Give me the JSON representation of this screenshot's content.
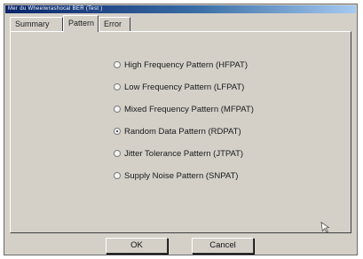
{
  "window": {
    "title": "Mer du Wheelwrashocal BER (Test )"
  },
  "tabs": [
    {
      "label": "Summary",
      "active": false
    },
    {
      "label": "Pattern",
      "active": true
    },
    {
      "label": "Error",
      "active": false
    }
  ],
  "options": [
    {
      "label": "High Frequency Pattern (HFPAT)",
      "selected": false
    },
    {
      "label": "Low Frequency Pattern (LFPAT)",
      "selected": false
    },
    {
      "label": "Mixed Frequency Pattern (MFPAT)",
      "selected": false
    },
    {
      "label": "Random Data Pattern (RDPAT)",
      "selected": true
    },
    {
      "label": "Jitter Tolerance Pattern (JTPAT)",
      "selected": false
    },
    {
      "label": "Supply Noise Pattern (SNPAT)",
      "selected": false
    }
  ],
  "buttons": {
    "ok": "OK",
    "cancel": "Cancel"
  },
  "icons": {
    "cursor": "mouse-pointer-icon"
  }
}
